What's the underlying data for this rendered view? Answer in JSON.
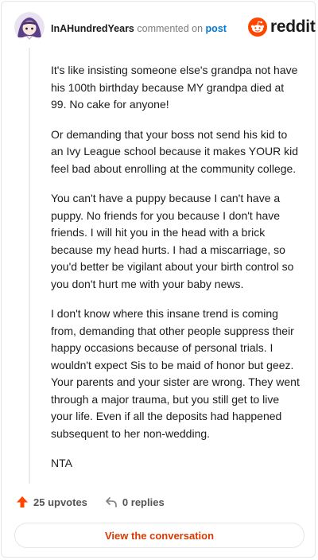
{
  "comment": {
    "username": "InAHundredYears",
    "commented_text": "commented on",
    "post_link_text": "post",
    "paragraphs": [
      "It's like insisting someone else's grandpa not have his 100th birthday because MY grandpa died at 99. No cake for anyone!",
      "Or demanding that your boss not send his kid to an Ivy League school because it makes YOUR kid feel bad about enrolling at the community college.",
      "You can't have a puppy because I can't have a puppy. No friends for you because I don't have friends. I will hit you in the head with a brick because my head hurts. I had a miscarriage, so you'd better be vigilant about your birth control so you don't hurt me with your baby news.",
      "I don't know where this insane trend is coming from, demanding that other people suppress their happy occasions because of personal trials. I wouldn't expect Sis to be maid of honor but geez. Your parents and your sister are wrong. They went through a major trauma, but you still get to live your life. Even if all the deposits had happened subsequent to her non-wedding.",
      "NTA"
    ],
    "upvotes_label": "25 upvotes",
    "replies_label": "0 replies",
    "cta_label": "View the conversation"
  },
  "brand": {
    "name": "reddit",
    "icon": "reddit-snoo-icon"
  },
  "colors": {
    "brand_orange": "#ff4500",
    "link_blue": "#0079d3",
    "cta_text": "#d93a00",
    "muted_text": "#7c7c7c"
  },
  "icons": {
    "avatar": "user-avatar",
    "upvote": "upvote-arrow-icon",
    "reply": "reply-arrow-icon"
  }
}
